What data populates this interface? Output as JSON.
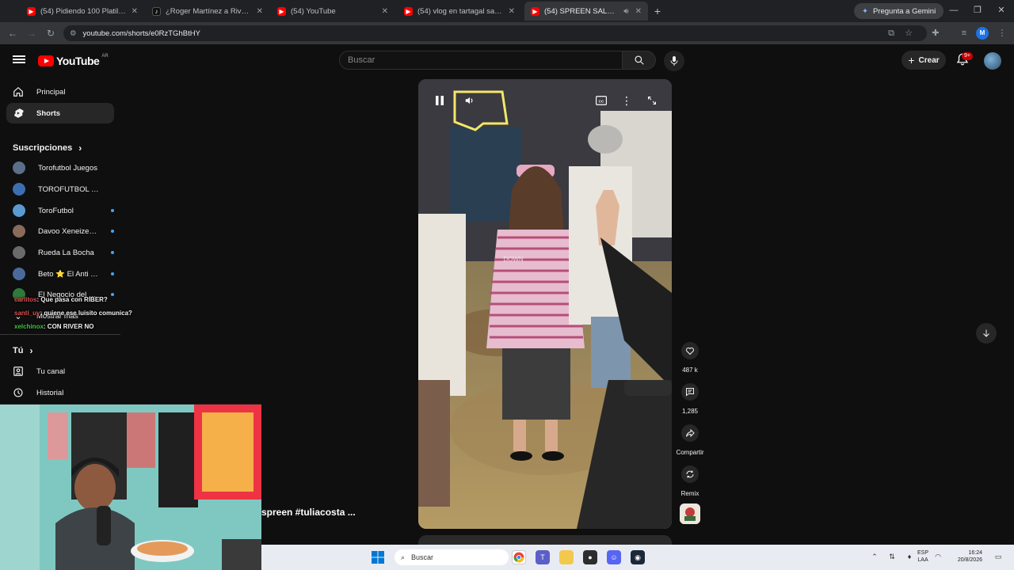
{
  "browser": {
    "tabs": [
      {
        "title": "(54) Pidiendo 100 Platillos Justo",
        "icon": "youtube-icon",
        "color": "#ff0000"
      },
      {
        "title": "¿Roger Martínez a River? Últim...",
        "icon": "tiktok-icon",
        "color": "#111111"
      },
      {
        "title": "(54) YouTube",
        "icon": "youtube-icon",
        "color": "#ff0000"
      },
      {
        "title": "(54) vlog en tartagal salta - You",
        "icon": "youtube-icon",
        "color": "#ff0000"
      },
      {
        "title": "(54) SPREEN SALUDA A TU",
        "icon": "youtube-icon",
        "color": "#ff0000"
      }
    ],
    "gemini_label": "Pregunta a Gemini",
    "url": "youtube.com/shorts/e0RzTGhBtHY",
    "profile_initial": "M"
  },
  "header": {
    "logo_text": "YouTube",
    "country_code": "AR",
    "search_placeholder": "Buscar",
    "create_label": "Crear",
    "notif_count": "9+"
  },
  "sidebar": {
    "items": [
      {
        "label": "Principal",
        "icon": "home-icon"
      },
      {
        "label": "Shorts",
        "icon": "shorts-icon"
      }
    ],
    "subs_heading": "Suscripciones",
    "subscriptions": [
      {
        "name": "Torofutbol Juegos",
        "color": "#5b6f8a",
        "live": false
      },
      {
        "name": "TOROFUTBOL KICK",
        "color": "#3d6fb0",
        "live": false
      },
      {
        "name": "ToroFutbol",
        "color": "#5b9ad1",
        "live": true
      },
      {
        "name": "Davoo Xeneize P...",
        "color": "#8a6b5b",
        "live": true
      },
      {
        "name": "Rueda La Bocha",
        "color": "#6a6a6a",
        "live": true
      },
      {
        "name": "Beto ⭐ El Anti T...",
        "color": "#4a6a9a",
        "live": true
      },
      {
        "name": "El Negocio del F...",
        "color": "#2f7a3a",
        "live": true
      }
    ],
    "show_more": "Mostrar más",
    "you_heading": "Tú",
    "you_items": [
      {
        "label": "Tu canal",
        "icon": "user-icon"
      },
      {
        "label": "Historial",
        "icon": "history-icon"
      }
    ]
  },
  "chat": [
    {
      "user": "carlitos",
      "text": ": Que pasa con RIBER?"
    },
    {
      "user": "santi_uy",
      "text": ": quiene ese luisito comunica?"
    },
    {
      "user": "xelchinox",
      "text": ": CON RIVER NO"
    }
  ],
  "short": {
    "title": "spreen #tuliacosta ...",
    "likes": "487 k",
    "comments": "1,285",
    "share_label": "Compartir",
    "remix_label": "Remix"
  },
  "taskbar": {
    "search_label": "Buscar",
    "lang_line1": "ESP",
    "lang_line2": "LAA",
    "time": "16:24",
    "date": "20/8/2026"
  }
}
